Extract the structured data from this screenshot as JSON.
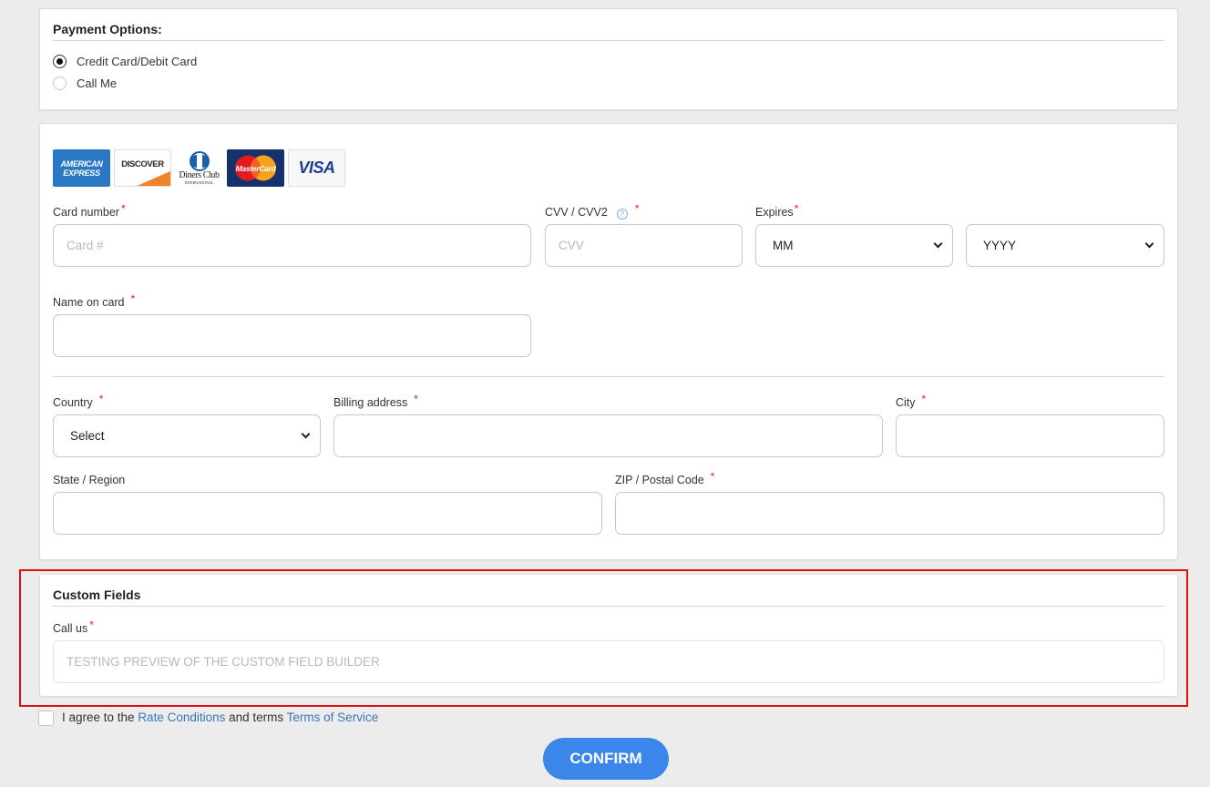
{
  "payment_options": {
    "title": "Payment Options:",
    "options": [
      {
        "label": "Credit Card/Debit Card",
        "selected": true
      },
      {
        "label": "Call Me",
        "selected": false
      }
    ]
  },
  "card_logos": {
    "amex": [
      "AMERICAN",
      "EXPRESS"
    ],
    "discover": "DISCOVER",
    "diners": [
      "Diners Club",
      "INTERNATIONAL"
    ],
    "mastercard": "MasterCard",
    "visa": "VISA"
  },
  "card_form": {
    "card_number_label": "Card number",
    "card_number_placeholder": "Card #",
    "cvv_label": "CVV / CVV2",
    "cvv_placeholder": "CVV",
    "expires_label": "Expires",
    "month_value": "MM",
    "year_value": "YYYY",
    "name_label": "Name on card",
    "required_mark": "*",
    "help_glyph": "?"
  },
  "address_form": {
    "country_label": "Country",
    "country_value": "Select",
    "billing_label": "Billing address",
    "city_label": "City",
    "state_label": "State / Region",
    "zip_label": "ZIP / Postal Code"
  },
  "custom_fields": {
    "title": "Custom Fields",
    "call_us_label": "Call us",
    "call_us_placeholder": "TESTING PREVIEW OF THE CUSTOM FIELD BUILDER"
  },
  "agreement": {
    "prefix": "I agree to the ",
    "rate_link": "Rate Conditions",
    "middle": " and terms ",
    "tos_link": "Terms of Service"
  },
  "confirm_label": "CONFIRM",
  "colors": {
    "accent": "#3b86ea",
    "link": "#3a78b9",
    "required": "#e02020",
    "highlight_border": "#e01010"
  }
}
